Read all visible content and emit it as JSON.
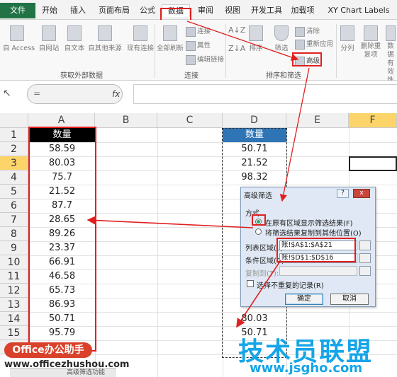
{
  "tabs": [
    "文件",
    "开始",
    "插入",
    "页面布局",
    "公式",
    "数据",
    "审阅",
    "视图",
    "开发工具",
    "加载项",
    "XY Chart Labels"
  ],
  "ribbon": {
    "get_data": [
      "自 Access",
      "自网站",
      "自文本",
      "自其他来源",
      "现有连接"
    ],
    "get_data_group": "获取外部数据",
    "refresh_all": "全部刷新",
    "conn_items": [
      "连接",
      "属性",
      "编辑链接"
    ],
    "conn_group": "连接",
    "sort": "排序",
    "filter": "筛选",
    "filter_items": [
      "清除",
      "重新应用",
      "高级"
    ],
    "sort_group": "排序和筛选",
    "tools": [
      "分列",
      "删除重复项",
      "数据有效性"
    ]
  },
  "formula_bar": {
    "name": "=",
    "fx": "fx"
  },
  "columns": [
    "A",
    "B",
    "C",
    "D",
    "E",
    "F"
  ],
  "rows": [
    "1",
    "2",
    "3",
    "4",
    "5",
    "6",
    "7",
    "8",
    "9",
    "10",
    "11",
    "12",
    "13",
    "14",
    "15",
    "16"
  ],
  "colA": [
    "数量",
    "58.59",
    "80.03",
    "75.7",
    "21.52",
    "87.7",
    "28.65",
    "89.26",
    "23.37",
    "66.91",
    "46.58",
    "65.73",
    "86.93",
    "50.71",
    "95.79"
  ],
  "colD": [
    "数量",
    "50.71",
    "21.52",
    "98.32",
    "80.03",
    "50.71"
  ],
  "dialog": {
    "title": "高级筛选",
    "help": "?",
    "close": "x",
    "mode_label": "方式",
    "option1": "在原有区域显示筛选结果(F)",
    "option2": "将筛选结果复制到其他位置(O)",
    "list_label": "列表区域(L):",
    "list_value": "账!$A$1:$A$21",
    "criteria_label": "条件区域(C):",
    "criteria_value": "账!$D$1:$D$16",
    "copy_label": "复制到(T):",
    "unique_label": "选择不重复的记录(R)",
    "ok": "确定",
    "cancel": "取消"
  },
  "watermarks": {
    "badge": "Office办公助手",
    "url1": "www.officezhushou.com",
    "url_tail": "高级筛选功能",
    "brand": "技术员联盟",
    "url2": "www.jsgho.com"
  },
  "colors": {
    "accent": "#217346",
    "highlight": "#e02020",
    "header_fill": "#000000",
    "selected": "#fcd46a",
    "criteria_fill": "#2f75b5"
  }
}
